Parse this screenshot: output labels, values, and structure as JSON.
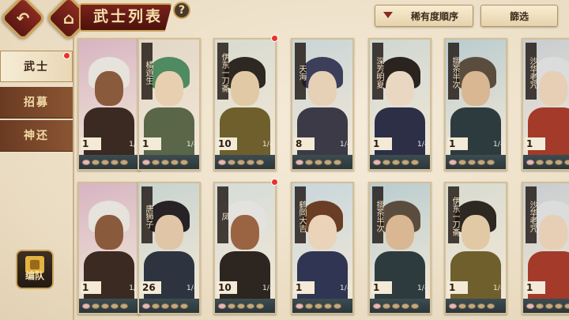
{
  "header": {
    "title": "武士列表",
    "back_icon": "back-arrow-icon",
    "home_icon": "home-icon",
    "help_label": "?",
    "sort_label": "稀有度順序",
    "filter_label": "篩选"
  },
  "sidebar": {
    "tabs": [
      {
        "label": "武士",
        "active": true,
        "has_alert": true
      },
      {
        "label": "招募",
        "active": false,
        "has_alert": false
      },
      {
        "label": "神还",
        "active": false,
        "has_alert": false
      }
    ],
    "team_button": {
      "label": "编队",
      "icon": "formation-icon"
    }
  },
  "cards": [
    {
      "name": "",
      "level": "1",
      "fraction": "1/",
      "alert": false,
      "palette": {
        "bg": "#d7b4c2",
        "hair": "#e6e2dc",
        "face": "#8a5a3c",
        "body": "#3a2a22"
      }
    },
    {
      "name": "橘遊生",
      "level": "1",
      "fraction": "1/-",
      "alert": false,
      "palette": {
        "bg": "#e3d7c7",
        "hair": "#4f8a60",
        "face": "#e8cfb0",
        "body": "#5a6648"
      }
    },
    {
      "name": "伊东一刀斋",
      "level": "10",
      "fraction": "1/-",
      "alert": true,
      "palette": {
        "bg": "#d8dbd0",
        "hair": "#2e2822",
        "face": "#e2c9a6",
        "body": "#6f5f2c"
      }
    },
    {
      "name": "天海",
      "level": "8",
      "fraction": "1/-",
      "alert": false,
      "palette": {
        "bg": "#c9d5d6",
        "hair": "#3c3f5a",
        "face": "#e6d0b6",
        "body": "#3b3a46"
      }
    },
    {
      "name": "深芳明夏",
      "level": "1",
      "fraction": "1/-",
      "alert": false,
      "palette": {
        "bg": "#cfd7d2",
        "hair": "#2a2320",
        "face": "#ead7c2",
        "body": "#2c2f46"
      }
    },
    {
      "name": "摺茶半次",
      "level": "1",
      "fraction": "1/-",
      "alert": false,
      "palette": {
        "bg": "#b9cccf",
        "hair": "#5b4d3e",
        "face": "#d9b792",
        "body": "#2d3b3e"
      }
    },
    {
      "name": "沙华老咒",
      "level": "1",
      "fraction": "1/-",
      "alert": false,
      "palette": {
        "bg": "#c8ccd0",
        "hair": "#dcdcdc",
        "face": "#e6cfb4",
        "body": "#a33a2a"
      }
    },
    {
      "name": "",
      "level": "1",
      "fraction": "1/",
      "alert": false,
      "palette": {
        "bg": "#d7b4c2",
        "hair": "#e6e2dc",
        "face": "#8a5a3c",
        "body": "#3a2a22"
      }
    },
    {
      "name": "唐狮子",
      "level": "26",
      "fraction": "1/-",
      "alert": false,
      "palette": {
        "bg": "#c7d3cf",
        "hair": "#262226",
        "face": "#e0c6a6",
        "body": "#2d3440"
      }
    },
    {
      "name": "凤",
      "level": "10",
      "fraction": "1/-",
      "alert": true,
      "palette": {
        "bg": "#d5dcd8",
        "hair": "#e4e2de",
        "face": "#9a6442",
        "body": "#2d2520"
      }
    },
    {
      "name": "鹤岡大吉",
      "level": "1",
      "fraction": "1/-",
      "alert": false,
      "palette": {
        "bg": "#c8d6dc",
        "hair": "#6a3e24",
        "face": "#ead3b8",
        "body": "#2f3552"
      }
    },
    {
      "name": "摺茶半次",
      "level": "1",
      "fraction": "1/-",
      "alert": false,
      "palette": {
        "bg": "#b9cccf",
        "hair": "#5b4d3e",
        "face": "#d9b792",
        "body": "#2d3b3e"
      }
    },
    {
      "name": "伊东一刀斋",
      "level": "1",
      "fraction": "1/-",
      "alert": false,
      "palette": {
        "bg": "#d8dbd0",
        "hair": "#2e2822",
        "face": "#e2c9a6",
        "body": "#6f5f2c"
      }
    },
    {
      "name": "沙华老咒",
      "level": "1",
      "fraction": "1/-",
      "alert": false,
      "palette": {
        "bg": "#c8ccd0",
        "hair": "#dcdcdc",
        "face": "#e6cfb4",
        "body": "#a33a2a"
      }
    }
  ]
}
